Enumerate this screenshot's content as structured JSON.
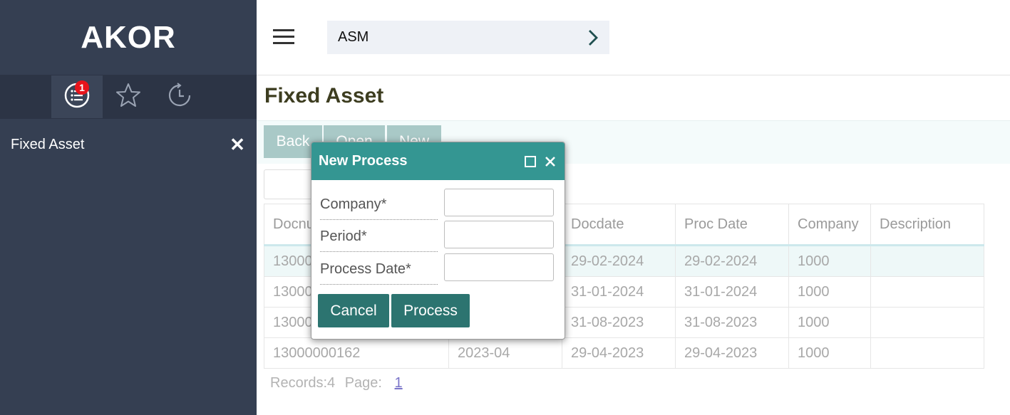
{
  "app": {
    "brand": "AKOR"
  },
  "sidebar": {
    "tabs": [
      {
        "icon": "list-icon",
        "badge": "1",
        "active": true
      },
      {
        "icon": "star-icon"
      },
      {
        "icon": "history-icon"
      }
    ],
    "open_item": {
      "label": "Fixed Asset",
      "close_glyph": "✕"
    }
  },
  "header": {
    "breadcrumb": "ASM"
  },
  "page": {
    "title": "Fixed Asset"
  },
  "toolbar": {
    "back": "Back",
    "open": "Open",
    "new": "New"
  },
  "table": {
    "columns": [
      "Docnu",
      "Docdate",
      "Proc Date",
      "Company",
      "Description"
    ],
    "rows": [
      {
        "docno": "13000",
        "period": "",
        "docdate": "29-02-2024",
        "proc_date": "29-02-2024",
        "company": "1000",
        "description": ""
      },
      {
        "docno": "13000",
        "period": "",
        "docdate": "31-01-2024",
        "proc_date": "31-01-2024",
        "company": "1000",
        "description": ""
      },
      {
        "docno": "13000",
        "period": "",
        "docdate": "31-08-2023",
        "proc_date": "31-08-2023",
        "company": "1000",
        "description": ""
      },
      {
        "docno": "13000000162",
        "period": "2023-04",
        "docdate": "29-04-2023",
        "proc_date": "29-04-2023",
        "company": "1000",
        "description": ""
      }
    ],
    "selected_row": 0
  },
  "footer": {
    "records": "Records:4",
    "page_label": "Page:",
    "page": "1"
  },
  "dialog": {
    "title": "New Process",
    "fields": [
      {
        "label": "Company*",
        "value": ""
      },
      {
        "label": "Period*",
        "value": ""
      },
      {
        "label": "Process Date*",
        "value": ""
      }
    ],
    "cancel": "Cancel",
    "process": "Process"
  },
  "colors": {
    "sidebar_bg": "#353f52",
    "dialog_header": "#349692",
    "primary_button": "#2c7470",
    "toolbar_button": "#a9c9c7",
    "badge": "#e8141b"
  }
}
